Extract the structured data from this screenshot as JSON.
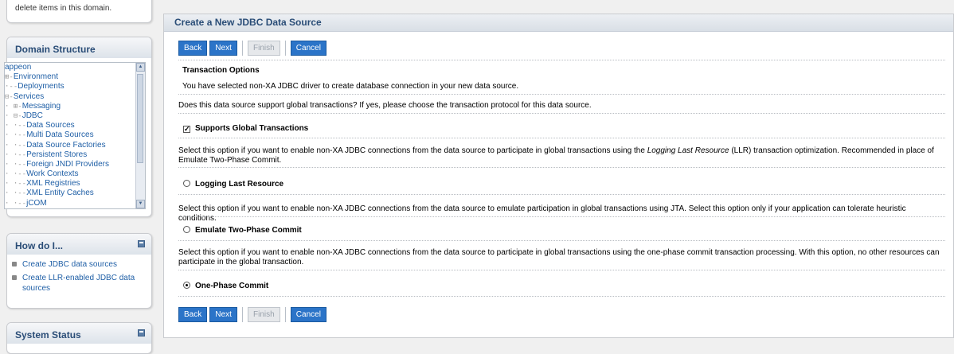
{
  "sidebar": {
    "top_panel_text": "delete items in this domain.",
    "domain_structure": {
      "title": "Domain Structure",
      "tree": [
        {
          "prefix": "",
          "label": "appeon"
        },
        {
          "prefix": "⊞-",
          "label": "Environment"
        },
        {
          "prefix": "·--",
          "label": "Deployments"
        },
        {
          "prefix": "⊟-",
          "label": "Services"
        },
        {
          "prefix": "·  ⊞-",
          "label": "Messaging"
        },
        {
          "prefix": "·  ⊟-",
          "label": "JDBC"
        },
        {
          "prefix": "·     ·--",
          "label": "Data Sources"
        },
        {
          "prefix": "·     ·--",
          "label": "Multi Data Sources"
        },
        {
          "prefix": "·     ·--",
          "label": "Data Source Factories"
        },
        {
          "prefix": "·  ·--",
          "label": "Persistent Stores"
        },
        {
          "prefix": "·  ·--",
          "label": "Foreign JNDI Providers"
        },
        {
          "prefix": "·  ·--",
          "label": "Work Contexts"
        },
        {
          "prefix": "·  ·--",
          "label": "XML Registries"
        },
        {
          "prefix": "·  ·--",
          "label": "XML Entity Caches"
        },
        {
          "prefix": "·  ·--",
          "label": "jCOM"
        }
      ]
    },
    "how_do_i": {
      "title": "How do I...",
      "items": [
        "Create JDBC data sources",
        "Create LLR-enabled JDBC data sources"
      ]
    },
    "system_status": {
      "title": "System Status"
    }
  },
  "main": {
    "title": "Create a New JDBC Data Source",
    "buttons": {
      "back": "Back",
      "next": "Next",
      "finish": "Finish",
      "cancel": "Cancel"
    },
    "section_title": "Transaction Options",
    "intro": "You have selected non-XA JDBC driver to create database connection in your new data source.",
    "question": "Does this data source support global transactions? If yes, please choose the transaction protocol for this data source.",
    "supports_global": {
      "label": "Supports Global Transactions",
      "checked": true
    },
    "llr_desc_a": "Select this option if you want to enable non-XA JDBC connections from the data source to participate in global transactions using the ",
    "llr_desc_em": "Logging Last Resource",
    "llr_desc_b": " (LLR) transaction optimization. Recommended in place of Emulate Two-Phase Commit.",
    "llr_label": "Logging Last Resource",
    "emulate_desc": "Select this option if you want to enable non-XA JDBC connections from the data source to emulate participation in global transactions using JTA. Select this option only if your application can tolerate heuristic conditions.",
    "emulate_label": "Emulate Two-Phase Commit",
    "onephase_desc": "Select this option if you want to enable non-XA JDBC connections from the data source to participate in global transactions using the one-phase commit transaction processing. With this option, no other resources can participate in the global transaction.",
    "onephase_label": "One-Phase Commit",
    "selected_protocol": "One-Phase Commit"
  }
}
